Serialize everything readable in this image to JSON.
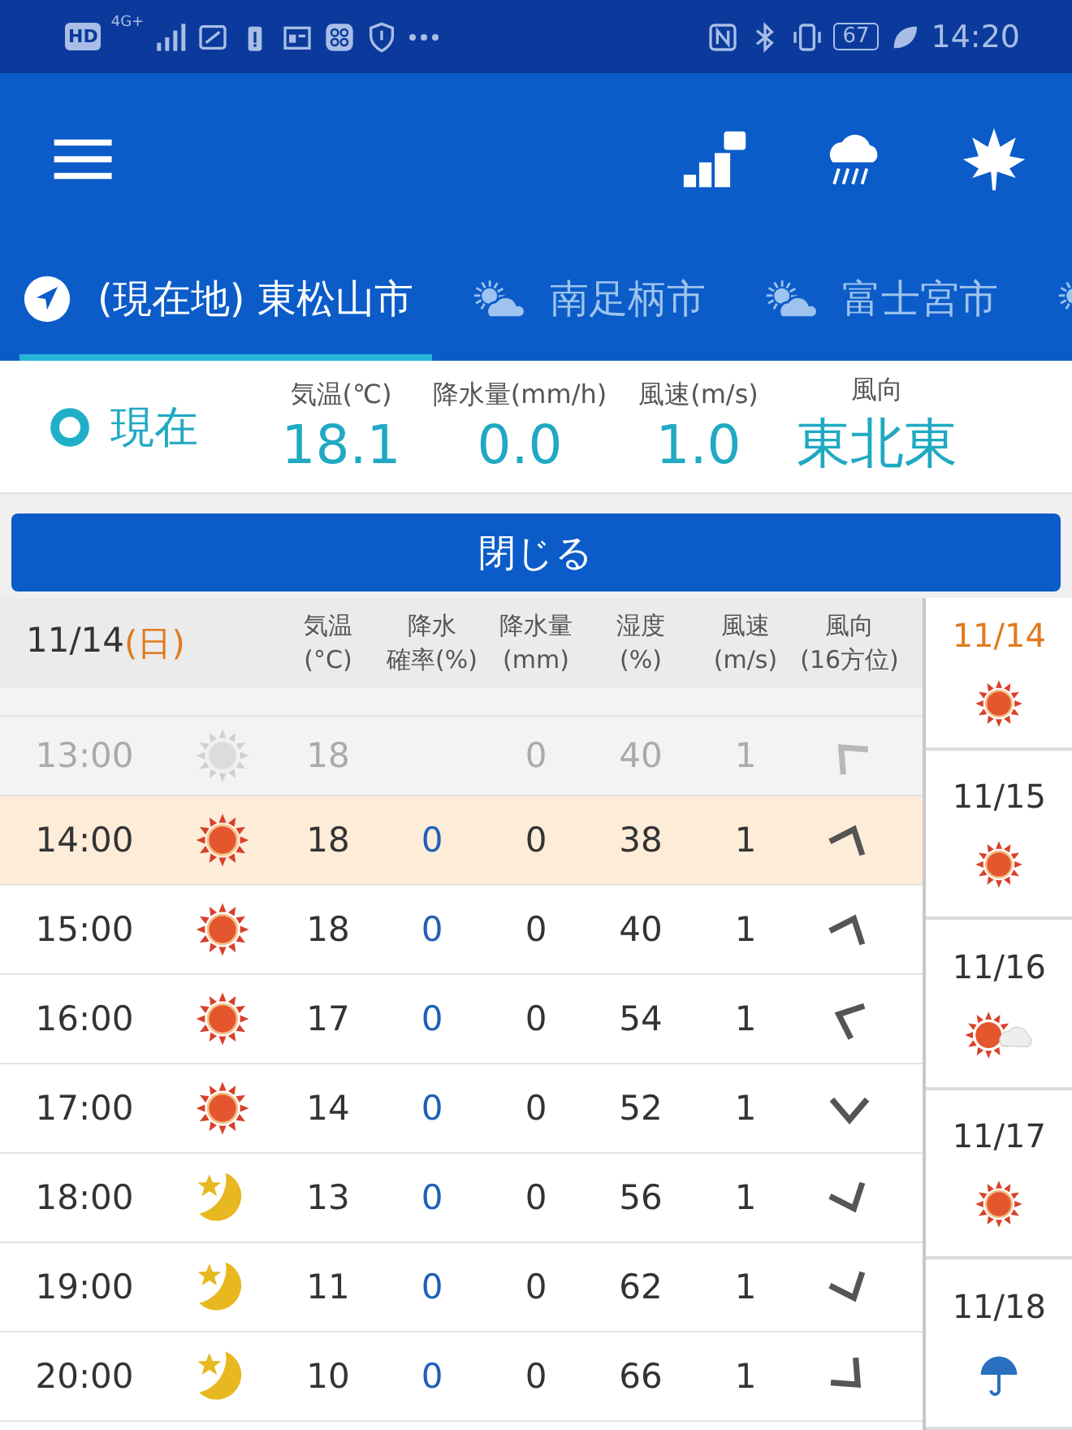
{
  "status_bar": {
    "hd": "HD",
    "network": "4G+",
    "battery": "67",
    "time": "14:20"
  },
  "tabs": [
    {
      "label": "(現在地) 東松山市",
      "kind": "location",
      "selected": true
    },
    {
      "label": "南足柄市",
      "kind": "weather",
      "selected": false
    },
    {
      "label": "富士宮市",
      "kind": "weather",
      "selected": false
    },
    {
      "kind": "weather",
      "selected": false
    }
  ],
  "current": {
    "label": "現在",
    "fields": [
      {
        "label": "気温(℃)",
        "value": "18.1"
      },
      {
        "label": "降水量(mm/h)",
        "value": "0.0"
      },
      {
        "label": "風速(m/s)",
        "value": "1.0"
      },
      {
        "label": "風向",
        "value": "東北東"
      }
    ]
  },
  "close_button": "閉じる",
  "hourly": {
    "date": "11/14",
    "weekday": "(日)",
    "holiday": true,
    "columns": [
      {
        "lines": [
          "気温",
          "(°C)"
        ]
      },
      {
        "lines": [
          "降水",
          "確率(%)"
        ]
      },
      {
        "lines": [
          "降水量",
          "(mm)"
        ]
      },
      {
        "lines": [
          "湿度",
          "(%)"
        ]
      },
      {
        "lines": [
          "風速",
          "(m/s)"
        ]
      },
      {
        "lines": [
          "風向",
          "(16方位)"
        ]
      }
    ],
    "rows": [
      {
        "time": "13:00",
        "weather": {
          "kind": "sun"
        },
        "temp": "18",
        "rain": "0",
        "humidity": "40",
        "wind": "1",
        "wind_icon": {
          "kind": "nw"
        },
        "past": true,
        "selected": false
      },
      {
        "time": "14:00",
        "weather": {
          "kind": "sun"
        },
        "temp": "18",
        "pop": "0",
        "rain": "0",
        "humidity": "38",
        "wind": "1",
        "wind_icon": {
          "kind": "nne"
        },
        "past": false,
        "selected": true
      },
      {
        "time": "15:00",
        "weather": {
          "kind": "sun"
        },
        "temp": "18",
        "pop": "0",
        "rain": "0",
        "humidity": "40",
        "wind": "1",
        "wind_icon": {
          "kind": "nne"
        },
        "past": false,
        "selected": false
      },
      {
        "time": "16:00",
        "weather": {
          "kind": "sun"
        },
        "temp": "17",
        "pop": "0",
        "rain": "0",
        "humidity": "54",
        "wind": "1",
        "wind_icon": {
          "kind": "wnw"
        },
        "past": false,
        "selected": false
      },
      {
        "time": "17:00",
        "weather": {
          "kind": "sun"
        },
        "temp": "14",
        "pop": "0",
        "rain": "0",
        "humidity": "52",
        "wind": "1",
        "wind_icon": {
          "kind": "s"
        },
        "past": false,
        "selected": false
      },
      {
        "time": "18:00",
        "weather": {
          "kind": "moon"
        },
        "temp": "13",
        "pop": "0",
        "rain": "0",
        "humidity": "56",
        "wind": "1",
        "wind_icon": {
          "kind": "sse"
        },
        "past": false,
        "selected": false
      },
      {
        "time": "19:00",
        "weather": {
          "kind": "moon"
        },
        "temp": "11",
        "pop": "0",
        "rain": "0",
        "humidity": "62",
        "wind": "1",
        "wind_icon": {
          "kind": "sse"
        },
        "past": false,
        "selected": false
      },
      {
        "time": "20:00",
        "weather": {
          "kind": "moon"
        },
        "temp": "10",
        "pop": "0",
        "rain": "0",
        "humidity": "66",
        "wind": "1",
        "wind_icon": {
          "kind": "se"
        },
        "past": false,
        "selected": false
      }
    ]
  },
  "days": [
    {
      "date": "11/14",
      "weather": {
        "kind": "sun"
      },
      "holiday": true
    },
    {
      "date": "11/15",
      "weather": {
        "kind": "sun"
      },
      "holiday": false
    },
    {
      "date": "11/16",
      "weather": {
        "kind": "sun-cloud"
      },
      "holiday": false
    },
    {
      "date": "11/17",
      "weather": {
        "kind": "sun"
      },
      "holiday": false
    },
    {
      "date": "11/18",
      "weather": {
        "kind": "umbrella"
      },
      "holiday": false
    }
  ]
}
